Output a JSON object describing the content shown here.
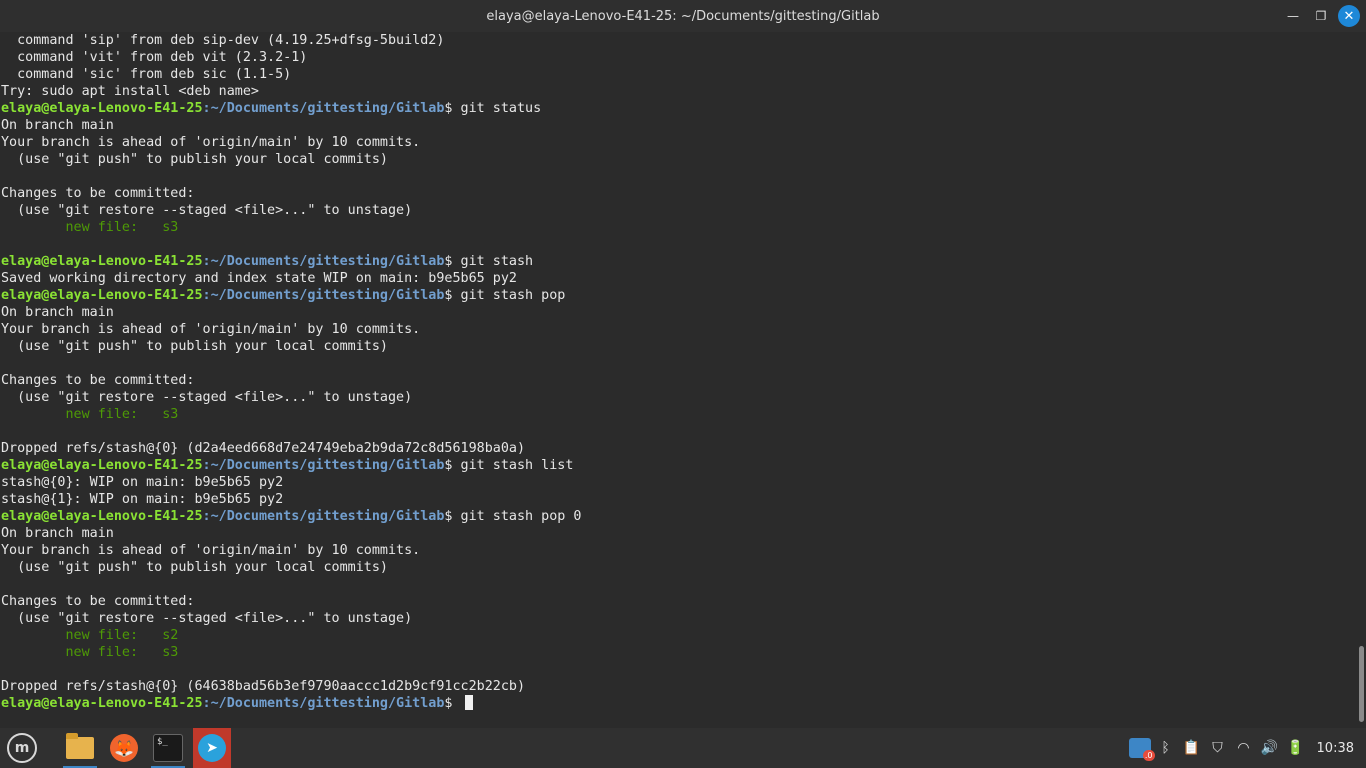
{
  "window": {
    "title": "elaya@elaya-Lenovo-E41-25: ~/Documents/gittesting/Gitlab",
    "minimize_glyph": "—",
    "maximize_glyph": "❐",
    "close_glyph": "✕"
  },
  "prompt": {
    "user": "elaya@elaya-Lenovo-E41-25",
    "path": ":~/Documents/gittesting/Gitlab",
    "symbol": "$ "
  },
  "lines": [
    {
      "t": "out",
      "text": "  command 'sip' from deb sip-dev (4.19.25+dfsg-5build2)"
    },
    {
      "t": "out",
      "text": "  command 'vit' from deb vit (2.3.2-1)"
    },
    {
      "t": "out",
      "text": "  command 'sic' from deb sic (1.1-5)"
    },
    {
      "t": "out",
      "text": "Try: sudo apt install <deb name>"
    },
    {
      "t": "prompt",
      "text": "git status"
    },
    {
      "t": "out",
      "text": "On branch main"
    },
    {
      "t": "out",
      "text": "Your branch is ahead of 'origin/main' by 10 commits."
    },
    {
      "t": "out",
      "text": "  (use \"git push\" to publish your local commits)"
    },
    {
      "t": "out",
      "text": ""
    },
    {
      "t": "out",
      "text": "Changes to be committed:"
    },
    {
      "t": "out",
      "text": "  (use \"git restore --staged <file>...\" to unstage)"
    },
    {
      "t": "green",
      "text": "\tnew file:   s3"
    },
    {
      "t": "out",
      "text": ""
    },
    {
      "t": "prompt",
      "text": "git stash"
    },
    {
      "t": "out",
      "text": "Saved working directory and index state WIP on main: b9e5b65 py2"
    },
    {
      "t": "prompt",
      "text": "git stash pop"
    },
    {
      "t": "out",
      "text": "On branch main"
    },
    {
      "t": "out",
      "text": "Your branch is ahead of 'origin/main' by 10 commits."
    },
    {
      "t": "out",
      "text": "  (use \"git push\" to publish your local commits)"
    },
    {
      "t": "out",
      "text": ""
    },
    {
      "t": "out",
      "text": "Changes to be committed:"
    },
    {
      "t": "out",
      "text": "  (use \"git restore --staged <file>...\" to unstage)"
    },
    {
      "t": "green",
      "text": "\tnew file:   s3"
    },
    {
      "t": "out",
      "text": ""
    },
    {
      "t": "out",
      "text": "Dropped refs/stash@{0} (d2a4eed668d7e24749eba2b9da72c8d56198ba0a)"
    },
    {
      "t": "prompt",
      "text": "git stash list"
    },
    {
      "t": "out",
      "text": "stash@{0}: WIP on main: b9e5b65 py2"
    },
    {
      "t": "out",
      "text": "stash@{1}: WIP on main: b9e5b65 py2"
    },
    {
      "t": "prompt",
      "text": "git stash pop 0"
    },
    {
      "t": "out",
      "text": "On branch main"
    },
    {
      "t": "out",
      "text": "Your branch is ahead of 'origin/main' by 10 commits."
    },
    {
      "t": "out",
      "text": "  (use \"git push\" to publish your local commits)"
    },
    {
      "t": "out",
      "text": ""
    },
    {
      "t": "out",
      "text": "Changes to be committed:"
    },
    {
      "t": "out",
      "text": "  (use \"git restore --staged <file>...\" to unstage)"
    },
    {
      "t": "green",
      "text": "\tnew file:   s2"
    },
    {
      "t": "green",
      "text": "\tnew file:   s3"
    },
    {
      "t": "out",
      "text": ""
    },
    {
      "t": "out",
      "text": "Dropped refs/stash@{0} (64638bad56b3ef9790aaccc1d2b9cf91cc2b22cb)"
    },
    {
      "t": "prompt",
      "text": "",
      "cursor": true
    }
  ],
  "taskbar": {
    "apps": [
      {
        "name": "menu-icon",
        "glyph": "m"
      },
      {
        "name": "folder-icon",
        "glyph": ""
      },
      {
        "name": "firefox-icon",
        "glyph": "🦊"
      },
      {
        "name": "terminal-icon",
        "glyph": "$_"
      },
      {
        "name": "telegram-icon",
        "glyph": "➤"
      }
    ],
    "tray": {
      "notification_badge": ".0",
      "bluetooth_glyph": "ᛒ",
      "clipboard_glyph": "📋",
      "shield_glyph": "⛉",
      "wifi_glyph": "◠",
      "volume_glyph": "🔊",
      "battery_glyph": "🔋",
      "clock": "10:38"
    },
    "colors": {
      "accent": "#3d86c6",
      "telegram_bg": "#c0392b"
    }
  },
  "colors": {
    "prompt_user": "#8ae234",
    "prompt_path": "#729fcf",
    "staged_file": "#4e9a06",
    "terminal_bg": "#2b2b2b"
  }
}
